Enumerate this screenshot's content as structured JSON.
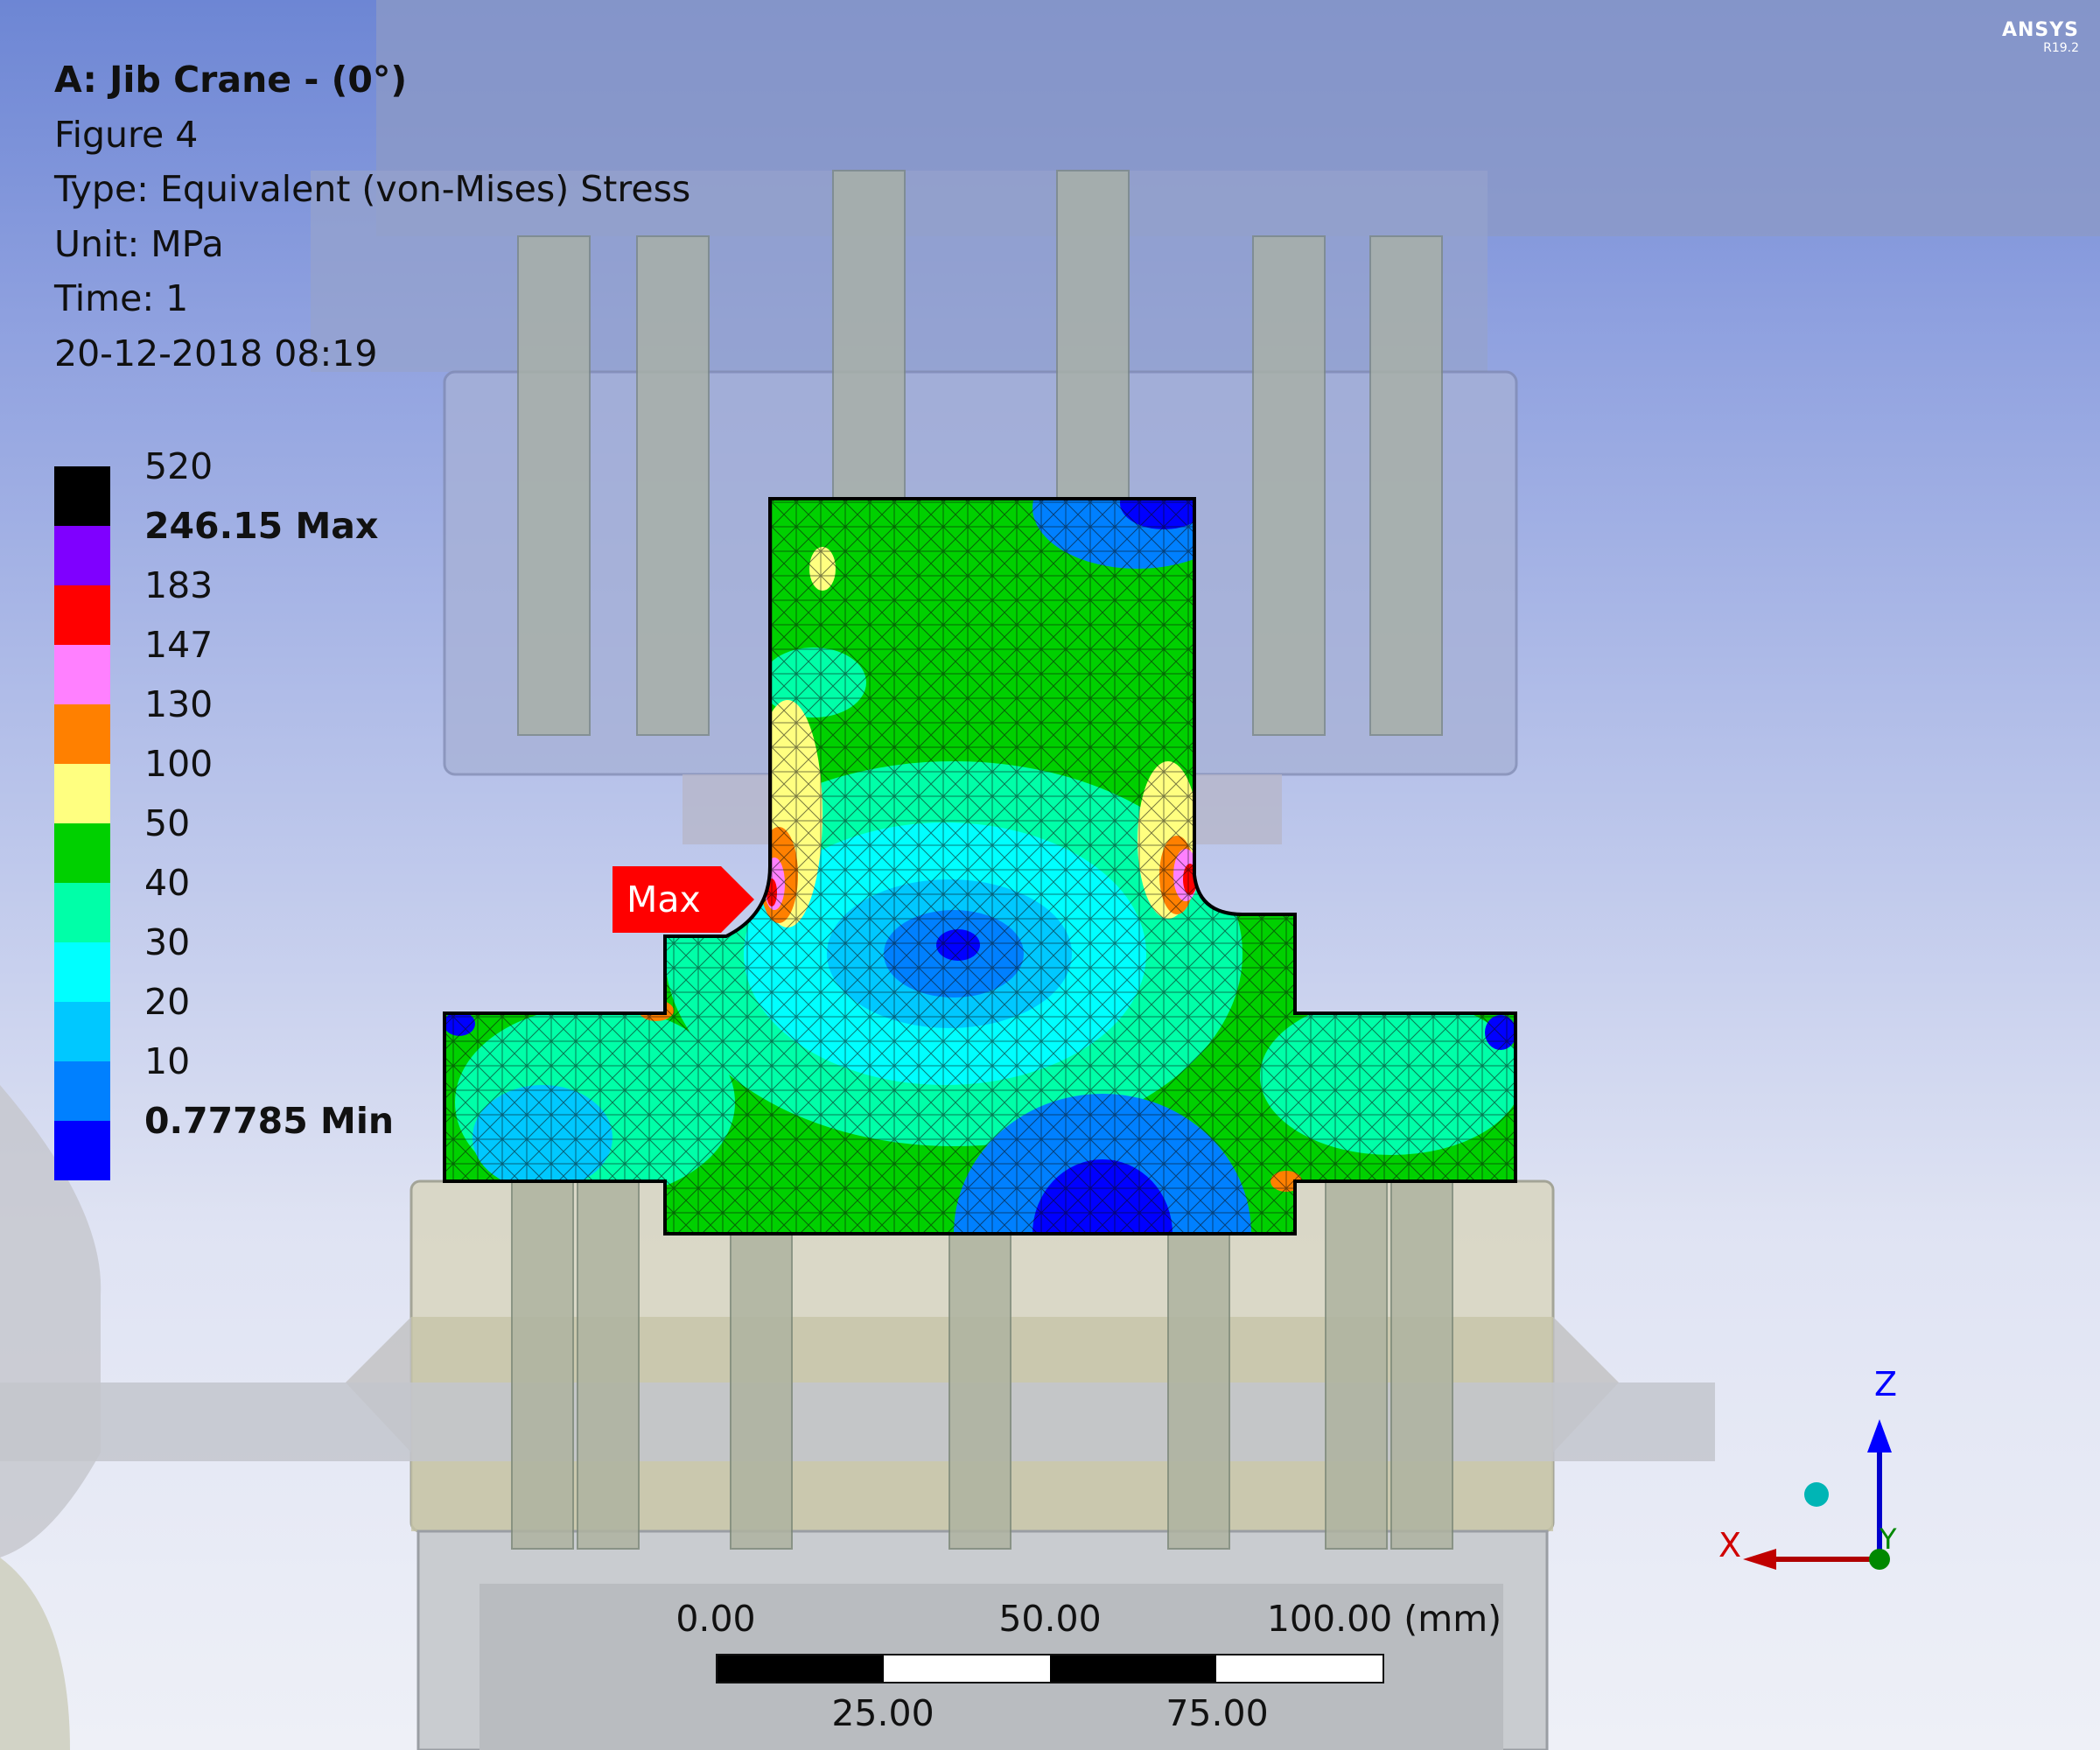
{
  "header": {
    "title": "A: Jib Crane - (0°)",
    "figure": "Figure 4",
    "type": "Type: Equivalent (von-Mises) Stress",
    "unit": "Unit: MPa",
    "time": "Time: 1",
    "datetime": "20-12-2018 08:19"
  },
  "logo": {
    "name": "ANSYS",
    "version": "R19.2"
  },
  "legend": {
    "colors": [
      "#000000",
      "#7f00ff",
      "#ff0000",
      "#ff80ff",
      "#ff8000",
      "#ffff80",
      "#00d000",
      "#00ffa8",
      "#00ffff",
      "#00c8ff",
      "#0080ff",
      "#0000ff"
    ],
    "labels": [
      {
        "text": "520",
        "bold": false
      },
      {
        "text": "246.15 Max",
        "bold": true
      },
      {
        "text": "183",
        "bold": false
      },
      {
        "text": "147",
        "bold": false
      },
      {
        "text": "130",
        "bold": false
      },
      {
        "text": "100",
        "bold": false
      },
      {
        "text": "50",
        "bold": false
      },
      {
        "text": "40",
        "bold": false
      },
      {
        "text": "30",
        "bold": false
      },
      {
        "text": "20",
        "bold": false
      },
      {
        "text": "10",
        "bold": false
      },
      {
        "text": "0.77785 Min",
        "bold": true
      }
    ]
  },
  "probe": {
    "max_label": "Max"
  },
  "scale": {
    "top_labels": [
      "0.00",
      "50.00",
      "100.00 (mm)"
    ],
    "bottom_labels": [
      "25.00",
      "75.00"
    ]
  },
  "triad": {
    "z": "Z",
    "x": "X",
    "y": "Y"
  }
}
